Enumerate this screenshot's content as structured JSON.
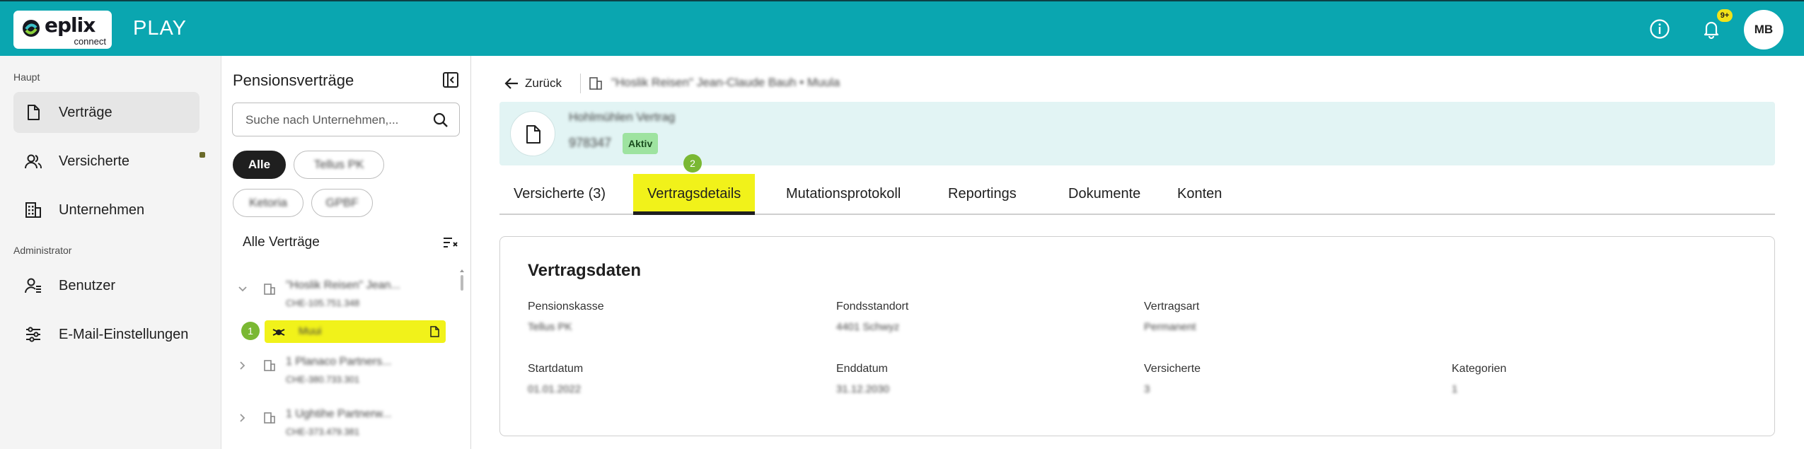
{
  "colors": {
    "brand": "#0aa6b0",
    "highlight": "#f1f21a",
    "status_active": "#9ee3a0",
    "step_marker": "#7ab833"
  },
  "topbar": {
    "logo_text": "eplix",
    "logo_sub": "connect",
    "app_title": "PLAY",
    "notification_badge": "9+",
    "avatar_initials": "MB",
    "icons": [
      "info-icon",
      "bell-icon"
    ]
  },
  "sidebar": {
    "section_main": "Haupt",
    "section_admin": "Administrator",
    "items": [
      {
        "label": "Verträge",
        "icon": "document-icon",
        "active": true
      },
      {
        "label": "Versicherte",
        "icon": "users-icon",
        "active": false
      },
      {
        "label": "Unternehmen",
        "icon": "building-icon",
        "active": false
      },
      {
        "label": "Benutzer",
        "icon": "user-admin-icon",
        "active": false
      },
      {
        "label": "E-Mail-Einstellungen",
        "icon": "sliders-icon",
        "active": false
      }
    ]
  },
  "list_panel": {
    "title": "Pensionsverträge",
    "search_placeholder": "Suche nach Unternehmen,...",
    "chips": [
      "Alle",
      "Tellus PK",
      "Ketoria",
      "GPBF"
    ],
    "list_title": "Alle Verträge",
    "rows": [
      {
        "name": "\"Hoslik Reisen\" Jean...",
        "id": "CHE-105.751.348"
      },
      {
        "name": "Muui",
        "id": ""
      },
      {
        "name": "1 Planaco Partners...",
        "id": "CHE-380.733.301"
      },
      {
        "name": "1 Ughtihe Partnerw...",
        "id": "CHE-373.479.381"
      }
    ],
    "step_marker": "1"
  },
  "main": {
    "back_label": "Zurück",
    "breadcrumb": "\"Hoslik Reisen\" Jean-Claude Bauh  •  Muula",
    "contract_name": "Hohlmühlen Vertrag",
    "contract_number": "978347",
    "status": "Aktiv",
    "step_marker": "2",
    "tabs": [
      "Versicherte (3)",
      "Vertragsdetails",
      "Mutationsprotokoll",
      "Reportings",
      "Dokumente",
      "Konten"
    ],
    "active_tab": 1,
    "card": {
      "title": "Vertragsdaten",
      "fields": [
        {
          "label": "Pensionskasse",
          "value": "Tellus PK"
        },
        {
          "label": "Fondsstandort",
          "value": "4401 Schwyz"
        },
        {
          "label": "Vertragsart",
          "value": "Permanent"
        },
        {
          "label": "Startdatum",
          "value": "01.01.2022"
        },
        {
          "label": "Enddatum",
          "value": "31.12.2030"
        },
        {
          "label": "Versicherte",
          "value": "3"
        },
        {
          "label": "Kategorien",
          "value": "1"
        }
      ]
    }
  }
}
